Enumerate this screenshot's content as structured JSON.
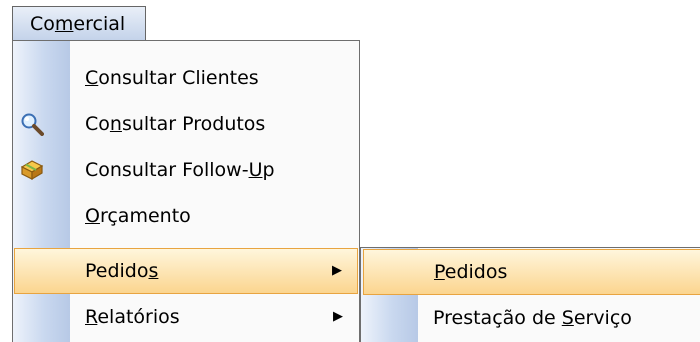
{
  "menubar": {
    "comercial": {
      "pre": "Co",
      "key": "m",
      "post": "ercial"
    }
  },
  "menu": {
    "items": [
      {
        "pre": "",
        "key": "C",
        "post": "onsultar Clientes",
        "icon": null
      },
      {
        "pre": "Co",
        "key": "n",
        "post": "sultar Produtos",
        "icon": "magnifier-icon"
      },
      {
        "pre": "Consultar Follow-",
        "key": "U",
        "post": "p",
        "icon": "folder-icon"
      },
      {
        "pre": "",
        "key": "O",
        "post": "rçamento",
        "icon": null
      },
      {
        "pre": "Pedido",
        "key": "s",
        "post": "",
        "icon": null,
        "submenu": true,
        "highlighted": true
      },
      {
        "pre": "",
        "key": "R",
        "post": "elatórios",
        "icon": null,
        "submenu": true
      }
    ],
    "submenu_arrow": "▶"
  },
  "submenu": {
    "items": [
      {
        "pre": "",
        "key": "P",
        "post": "edidos",
        "highlighted": true
      },
      {
        "pre": "Prestação de ",
        "key": "S",
        "post": "erviço"
      }
    ]
  },
  "colors": {
    "highlight_top": "#fff6dc",
    "highlight_bottom": "#fbd58f",
    "highlight_border": "#e8a440",
    "gutter": "#c9d8ef"
  }
}
